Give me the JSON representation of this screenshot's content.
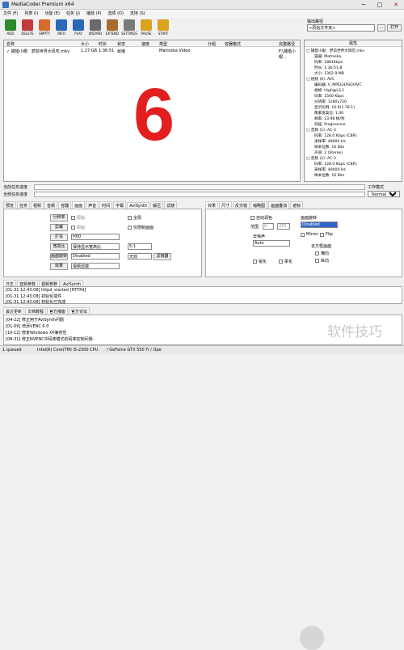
{
  "window": {
    "title": "MediaCoder Premium x64",
    "minimize": "─",
    "maximize": "□",
    "close": "✕"
  },
  "menu": [
    "文件 (F)",
    "列表 (I)",
    "功能 (E)",
    "任务 (J)",
    "播放 (P)",
    "选项 (O)",
    "支持 (S)"
  ],
  "toolbar": [
    {
      "label": "ADD",
      "color": "#2f8a2f"
    },
    {
      "label": "DELETE",
      "color": "#c23b3b"
    },
    {
      "label": "EMPTY",
      "color": "#d96a2e"
    },
    {
      "label": "INFO",
      "color": "#2b68b8"
    },
    {
      "label": "PLAY",
      "color": "#2b68b8"
    },
    {
      "label": "WIZARD",
      "color": "#6a6a6a"
    },
    {
      "label": "EXTEND",
      "color": "#a76b2e"
    },
    {
      "label": "SETTINGS",
      "color": "#7a7a7a"
    },
    {
      "label": "PAUSE",
      "color": "#d9a21f"
    },
    {
      "label": "START",
      "color": "#d9a21f"
    }
  ],
  "output": {
    "label": "输出路径",
    "value": "<原始文件夹>",
    "browse": "...",
    "open": "打开"
  },
  "filelist": {
    "headers": [
      "名称",
      "大小",
      "时长",
      "状态",
      "速度",
      "类型",
      "分组",
      "容器格式",
      "完整路径"
    ],
    "rows": [
      {
        "name": "✓ 捕猎小眼：梦前世界大风吃.mkv",
        "size": "1.27 GB",
        "duration": "1:36:51",
        "status": "就绪",
        "speed": "",
        "type": "Matroska Video",
        "group": "",
        "container": "",
        "path": "F:\\捕猎小眼..."
      }
    ]
  },
  "badge": "6",
  "properties": {
    "header": "属性",
    "lines": [
      "□ 捕猎小眼：梦前世界大风吃.mkv",
      "容器: Matroska",
      "码率: 1881Kbps",
      "时长: 1:36:51.8",
      "大小: 1302.9 MB",
      "□ 视频 (0): AVC",
      "编码器: V_MPEG4/ISO/AVC",
      "规格: High@L3.1",
      "码率: 1500 Kbps",
      "分辨率: 1280x720",
      "显示比例: 16:9(1.78:1)",
      "像素宽高比: 1.00",
      "帧率: 23.98 帧/秒",
      "扫描: Progressive",
      "□ 音频 (1): AC-3",
      "码率: 128.0 Kbps (CBR)",
      "采样率: 48000 Hz",
      "样本位数: 16 Bits",
      "声道: 2 (Stereo)",
      "□ 音频 (2): AC-3",
      "码率: 128.0 Kbps (CBR)",
      "采样率: 48000 Hz",
      "样本位数: 16 Bits"
    ]
  },
  "progress": {
    "current": "当前任务进度",
    "total": "全部任务进度",
    "work_mode_label": "工作模式",
    "work_mode": "Normal"
  },
  "left_tabs": [
    "预览",
    "任务",
    "视频",
    "音频",
    "容器",
    "画面",
    "声音",
    "时间",
    "字幕",
    "AviSynth",
    "解压",
    "滤镜"
  ],
  "left_tabs_selected": "画面",
  "picture": {
    "crop": "分辨率",
    "scale": "剪裁",
    "expand": "扩充",
    "deinterlace": "画面旋转",
    "aspect": "宽高比",
    "denoise": "画面翻转",
    "effects": "效果",
    "chk_original": "原始",
    "chk_original2": "原始",
    "res_value": "H00",
    "ar_value": "保持显示宽高比",
    "rotate_value": "Disabled",
    "ratio_value": "5:1",
    "effect_value": "视频滤镜",
    "chk_all": "全局",
    "chk_fullrange": "仅限制画面",
    "wizard_btn": "滤镜器",
    "ratio_select": "无效"
  },
  "right_tabs": [
    "效果",
    "尺寸",
    "反交错",
    "缩略图",
    "画面叠加",
    "遮标"
  ],
  "right_tabs_selected": "效果",
  "effects": {
    "auto_level": "自动调色",
    "range": "范围",
    "range_from": "0",
    "range_to": "255",
    "deblock": "去噪声",
    "deblock_value": "Auto",
    "sharpen": "锐化",
    "soften": "柔化",
    "flip_label": "画面旋转",
    "flip_value": "Disabled",
    "mirror": "Mirror",
    "flip": "Flip",
    "delogo_label": "去方框画面",
    "delogo_h": "横向",
    "delogo_v": "纵向"
  },
  "log": {
    "tabs": [
      "日志",
      "音频参数",
      "视频参数",
      "AviSynth"
    ],
    "lines": [
      "[01-31 12:43:08] httpd_started [HTTPd]",
      "[01-31 12:43:08] 初始化插件",
      "[01-31 12:43:08] 初始化已完成"
    ]
  },
  "news": {
    "tabs": [
      "最近更新",
      "文档教程",
      "官方播客",
      "官方论坛"
    ],
    "lines": [
      "[04-22] 修正用于AviSynth问题",
      "[01-09] 增添VENC 6.0",
      "[10-12] 修复Windows XP兼容性",
      "[08-31] 修正NVENC中码率模式的码率控制问题-"
    ]
  },
  "status": {
    "queue": "1 queued",
    "cpu": "Intel(R) Core(TM) i5-2300 CPU",
    "gpu": "/ GeForce GTX 550 Ti / Ope"
  },
  "watermark": "软件技巧"
}
